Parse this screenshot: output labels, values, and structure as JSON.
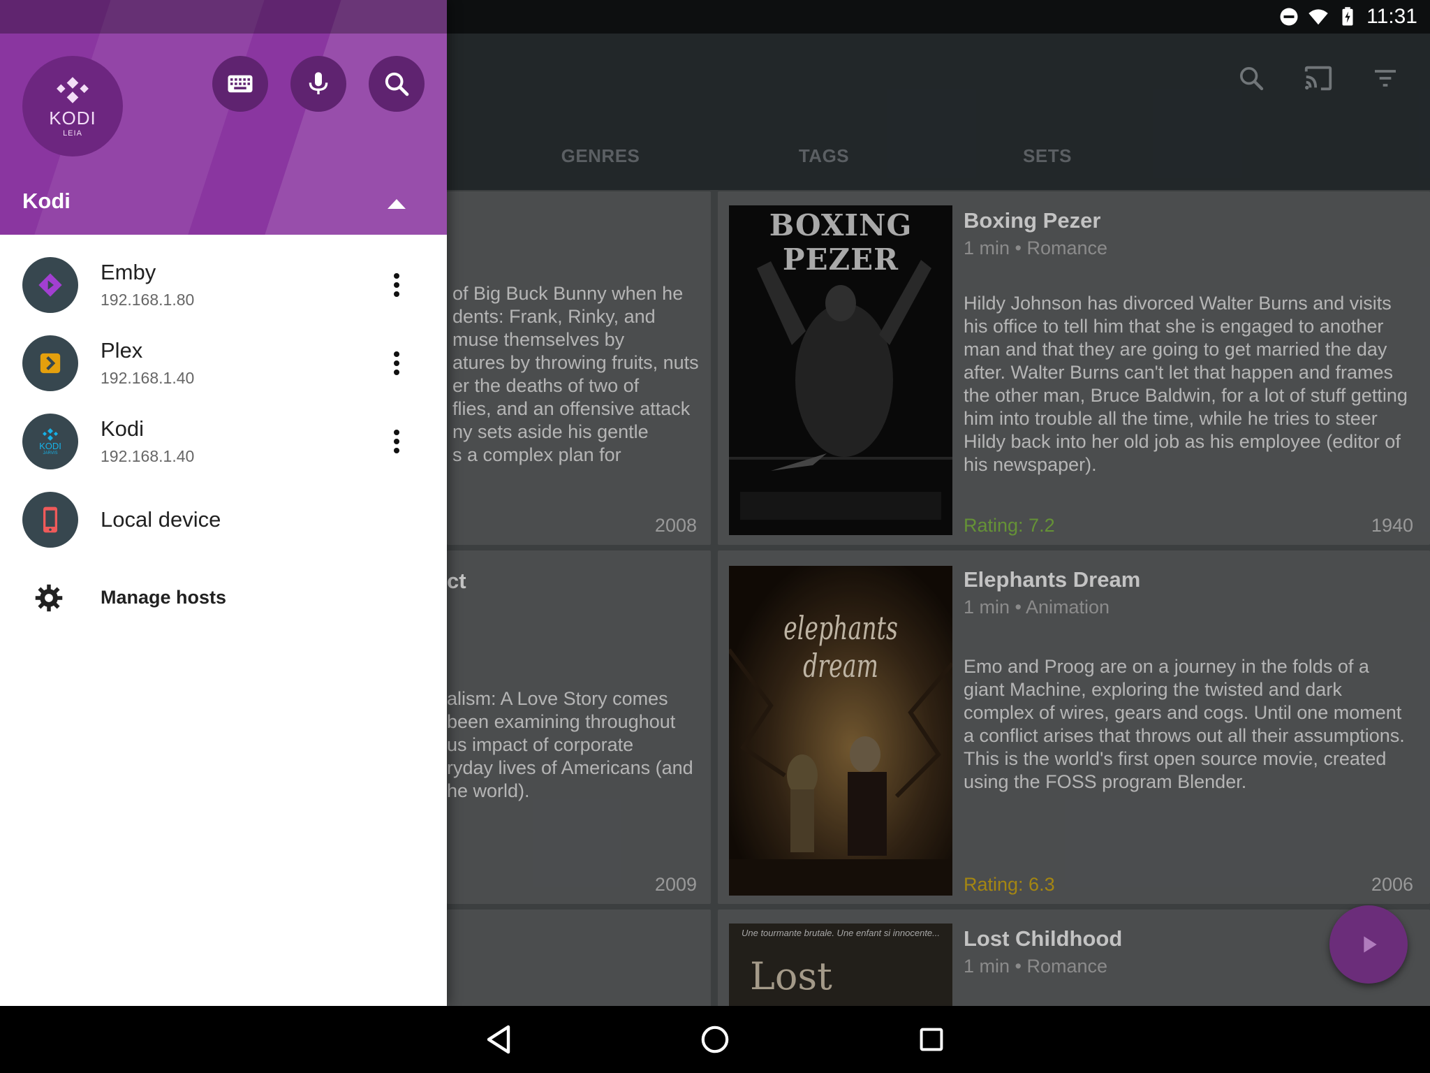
{
  "status_bar": {
    "time": "11:31"
  },
  "tabs": [
    "GENRES",
    "TAGS",
    "SETS"
  ],
  "left_cards": [
    {
      "title_fragment": "",
      "description_fragment": "of Big Buck Bunny when he\ndents: Frank, Rinky, and\nmuse themselves by\natures by throwing fruits, nuts\ner the deaths of two of\nflies, and an offensive attack\nny sets aside his gentle\ns a complex plan for",
      "year": "2008"
    },
    {
      "title_fragment": "ct",
      "description_fragment": "alism: A Love Story comes\nbeen examining throughout\nus impact of corporate\nryday lives of Americans (and\nhe world).",
      "year": "2009"
    }
  ],
  "movies": [
    {
      "title": "Boxing Pezer",
      "meta": "1 min • Romance",
      "description": "Hildy Johnson has divorced Walter Burns and visits his office to tell him that she is engaged to another man and that they are going to get married the day after. Walter Burns can't let that happen and frames the other man, Bruce Baldwin, for a lot of stuff getting him into trouble all the time, while he tries to steer Hildy back into her old job as his employee (editor of his newspaper).",
      "rating": "Rating: 7.2",
      "rating_color": "#7cb342",
      "year": "1940",
      "poster_text": "BOXING PEZER"
    },
    {
      "title": "Elephants Dream",
      "meta": "1 min • Animation",
      "description": "Emo and Proog are on a journey in the folds of a giant Machine, exploring the twisted and dark complex of wires, gears and cogs. Until one moment a conflict arises that throws out all their assumptions. This is the world's first open source movie, created using the FOSS program Blender.",
      "rating": "Rating: 6.3",
      "rating_color": "#c8a416",
      "year": "2006",
      "poster_text": "elephants dream"
    },
    {
      "title": "Lost Childhood",
      "meta": "1 min • Romance",
      "poster_text": "Lost",
      "poster_tagline": "Une tourmante brutale. Une enfant si innocente..."
    }
  ],
  "drawer": {
    "logo_text": "KODI",
    "logo_subtext": "LEIA",
    "current_host": "Kodi",
    "hosts": [
      {
        "name": "Emby",
        "address": "192.168.1.80",
        "icon": "emby-icon",
        "accent": "#a23fd1"
      },
      {
        "name": "Plex",
        "address": "192.168.1.40",
        "icon": "plex-icon",
        "accent": "#e5a00d"
      },
      {
        "name": "Kodi",
        "address": "192.168.1.40",
        "icon": "kodi-icon",
        "accent": "#17b2e7",
        "logo_text": "KODI",
        "logo_subtext": "JARVIS"
      }
    ],
    "local_device": "Local device",
    "manage_hosts": "Manage hosts"
  },
  "colors": {
    "accent": "#8a36a0",
    "fab": "#6b2d7a"
  }
}
